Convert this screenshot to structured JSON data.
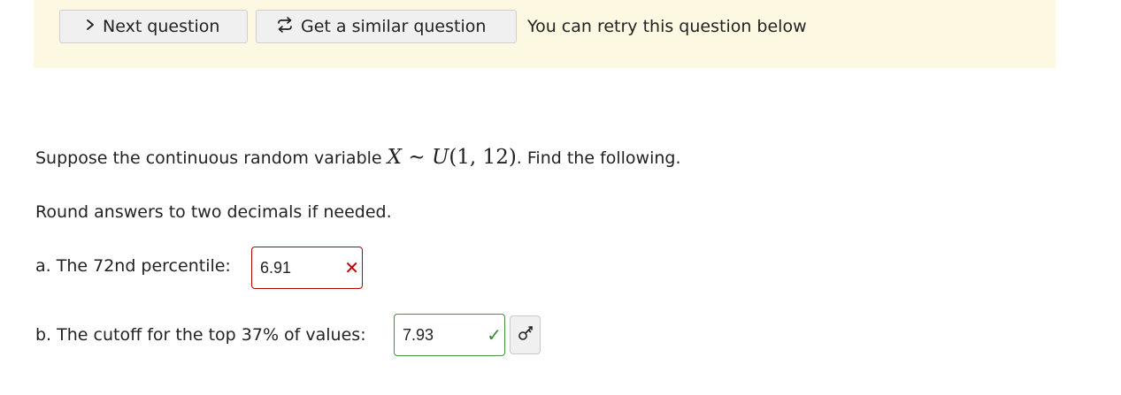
{
  "toolbar": {
    "next_label": "Next question",
    "similar_label": "Get a similar question",
    "retry_text": "You can retry this question below"
  },
  "question": {
    "intro_before": "Suppose the continuous random variable ",
    "intro_after": ". Find the following.",
    "rounding_note": "Round answers to two decimals if needed.",
    "math": {
      "variable": "X",
      "relation": "∼",
      "distribution": "U",
      "params": "(1, 12)"
    },
    "parts": [
      {
        "label": "a. The 72nd percentile:",
        "value": "6.91",
        "status": "incorrect"
      },
      {
        "label": "b. The cutoff for the top 37% of values:",
        "value": "7.93",
        "status": "correct"
      }
    ]
  },
  "icons": {
    "next": "chevron-right-icon",
    "similar": "repeat-icon",
    "incorrect": "x-mark-icon",
    "correct": "check-mark-icon",
    "key": "key-icon"
  },
  "colors": {
    "banner_bg": "#fdf8e1",
    "incorrect": "#c00000",
    "correct": "#2e8b2e"
  }
}
